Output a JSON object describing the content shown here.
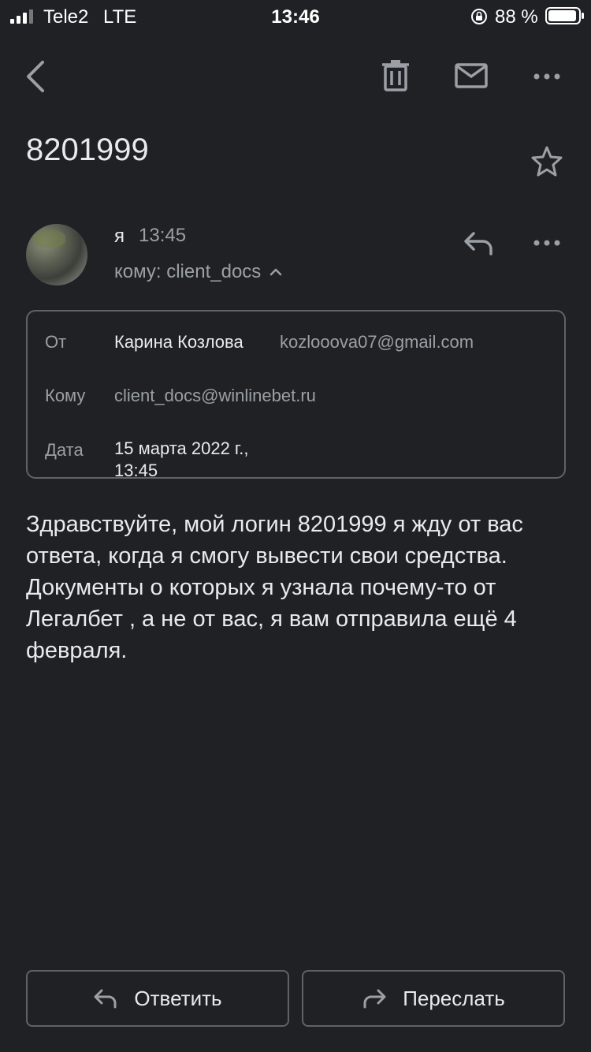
{
  "status_bar": {
    "carrier": "Tele2",
    "network": "LTE",
    "time": "13:46",
    "battery_percent": "88 %"
  },
  "toolbar": {
    "icons": [
      "back-icon",
      "trash-icon",
      "mail-icon",
      "more-horizontal-icon"
    ]
  },
  "email": {
    "subject": "8201999",
    "sender": "я",
    "time": "13:45",
    "to_summary": "кому: client_docs",
    "details": {
      "from_label": "От",
      "from_name": "Карина Козлова",
      "from_email": "kozlooova07@gmail.com",
      "to_label": "Кому",
      "to_value": "client_docs@winlinebet.ru",
      "date_label": "Дата",
      "date_value": "15 марта 2022 г.,\n13:45"
    },
    "body": "Здравствуйте, мой логин 8201999 я жду от вас ответа, когда я смогу вывести свои средства. Документы о которых я узнала почему-то от Легалбет , а не от вас, я вам отправила ещё 4 февраля."
  },
  "actions": {
    "reply_label": "Ответить",
    "forward_label": "Переслать"
  },
  "colors": {
    "background": "#202124",
    "text": "#e8eaed",
    "secondary_text": "#9aa0a6",
    "border": "#5f6368"
  }
}
